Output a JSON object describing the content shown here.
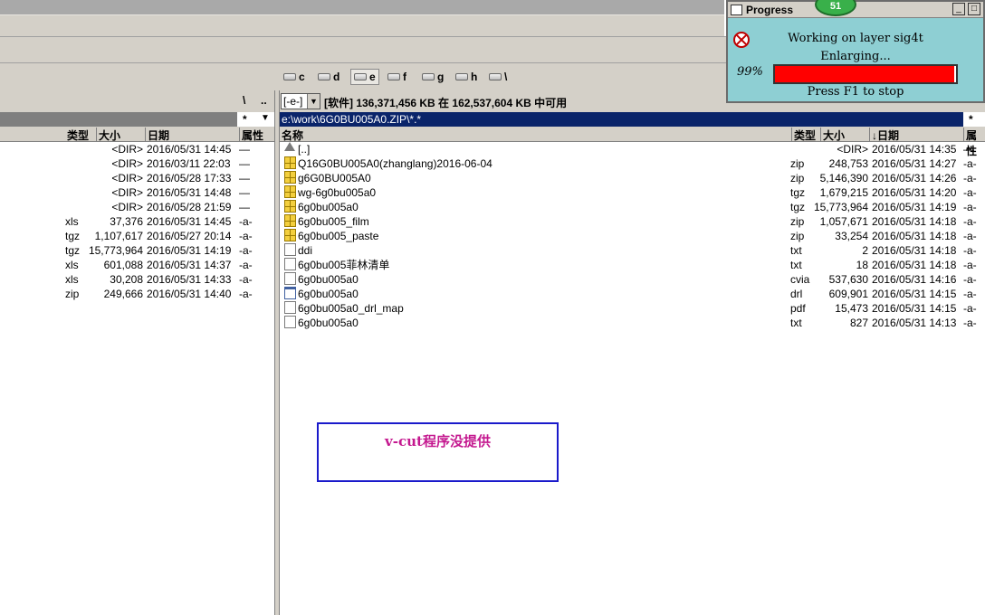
{
  "drives": [
    {
      "letter": "c",
      "active": false
    },
    {
      "letter": "d",
      "active": false
    },
    {
      "letter": "e",
      "active": true
    },
    {
      "letter": "f",
      "active": false
    },
    {
      "letter": "g",
      "active": false
    },
    {
      "letter": "h",
      "active": false
    },
    {
      "letter": "\\",
      "active": false
    }
  ],
  "left_panel": {
    "root_btn": "\\",
    "up_btn": "..",
    "star": "*",
    "headers": {
      "type": "类型",
      "size": "大小",
      "date": "日期",
      "attr": "属性"
    },
    "rows": [
      {
        "type": "",
        "size": "<DIR>",
        "date": "2016/05/31 14:45",
        "attr": "—"
      },
      {
        "type": "",
        "size": "<DIR>",
        "date": "2016/03/11 22:03",
        "attr": "—"
      },
      {
        "type": "",
        "size": "<DIR>",
        "date": "2016/05/28 17:33",
        "attr": "—"
      },
      {
        "type": "",
        "size": "<DIR>",
        "date": "2016/05/31 14:48",
        "attr": "—"
      },
      {
        "type": "",
        "size": "<DIR>",
        "date": "2016/05/28 21:59",
        "attr": "—"
      },
      {
        "type": "xls",
        "size": "37,376",
        "date": "2016/05/31 14:45",
        "attr": "-a-"
      },
      {
        "type": "tgz",
        "size": "1,107,617",
        "date": "2016/05/27 20:14",
        "attr": "-a-"
      },
      {
        "type": "tgz",
        "size": "15,773,964",
        "date": "2016/05/31 14:19",
        "attr": "-a-"
      },
      {
        "type": "xls",
        "size": "601,088",
        "date": "2016/05/31 14:37",
        "attr": "-a-"
      },
      {
        "type": "xls",
        "size": "30,208",
        "date": "2016/05/31 14:33",
        "attr": "-a-"
      },
      {
        "type": "zip",
        "size": "249,666",
        "date": "2016/05/31 14:40",
        "attr": "-a-"
      }
    ]
  },
  "right_panel": {
    "drive_select": "[-e-]",
    "free_space": "[软件]  136,371,456 KB 在 162,537,604 KB 中可用",
    "path": "e:\\work\\6G0BU005A0.ZIP\\*.*",
    "star": "*",
    "headers": {
      "name": "名称",
      "type": "类型",
      "size": "大小",
      "date": "↓日期",
      "attr": "属性"
    },
    "rows": [
      {
        "icon": "up",
        "name": "[..]",
        "type": "",
        "size": "<DIR>",
        "date": "2016/05/31 14:35",
        "attr": "—"
      },
      {
        "icon": "zip",
        "name": "Q16G0BU005A0(zhanglang)2016-06-04",
        "type": "zip",
        "size": "248,753",
        "date": "2016/05/31 14:27",
        "attr": "-a-"
      },
      {
        "icon": "zip",
        "name": "g6G0BU005A0",
        "type": "zip",
        "size": "5,146,390",
        "date": "2016/05/31 14:26",
        "attr": "-a-"
      },
      {
        "icon": "zip",
        "name": "wg-6g0bu005a0",
        "type": "tgz",
        "size": "1,679,215",
        "date": "2016/05/31 14:20",
        "attr": "-a-"
      },
      {
        "icon": "zip",
        "name": "6g0bu005a0",
        "type": "tgz",
        "size": "15,773,964",
        "date": "2016/05/31 14:19",
        "attr": "-a-"
      },
      {
        "icon": "zip",
        "name": "6g0bu005_film",
        "type": "zip",
        "size": "1,057,671",
        "date": "2016/05/31 14:18",
        "attr": "-a-"
      },
      {
        "icon": "zip",
        "name": "6g0bu005_paste",
        "type": "zip",
        "size": "33,254",
        "date": "2016/05/31 14:18",
        "attr": "-a-"
      },
      {
        "icon": "txt",
        "name": "ddi",
        "type": "txt",
        "size": "2",
        "date": "2016/05/31 14:18",
        "attr": "-a-"
      },
      {
        "icon": "txt",
        "name": "6g0bu005菲林清单",
        "type": "txt",
        "size": "18",
        "date": "2016/05/31 14:18",
        "attr": "-a-"
      },
      {
        "icon": "txt",
        "name": "6g0bu005a0",
        "type": "cvia",
        "size": "537,630",
        "date": "2016/05/31 14:16",
        "attr": "-a-"
      },
      {
        "icon": "drl",
        "name": "6g0bu005a0",
        "type": "drl",
        "size": "609,901",
        "date": "2016/05/31 14:15",
        "attr": "-a-"
      },
      {
        "icon": "txt",
        "name": "6g0bu005a0_drl_map",
        "type": "pdf",
        "size": "15,473",
        "date": "2016/05/31 14:15",
        "attr": "-a-"
      },
      {
        "icon": "txt",
        "name": "6g0bu005a0",
        "type": "txt",
        "size": "827",
        "date": "2016/05/31 14:13",
        "attr": "-a-"
      }
    ]
  },
  "note_box": {
    "text": "v-cut程序没提供"
  },
  "progress": {
    "title": "Progress",
    "badge": "51",
    "line1": "Working on layer sig4t",
    "line2": "Enlarging...",
    "percent_label": "99%",
    "percent": 99,
    "hint": "Press F1 to stop",
    "bar_color": "#ff0000"
  }
}
